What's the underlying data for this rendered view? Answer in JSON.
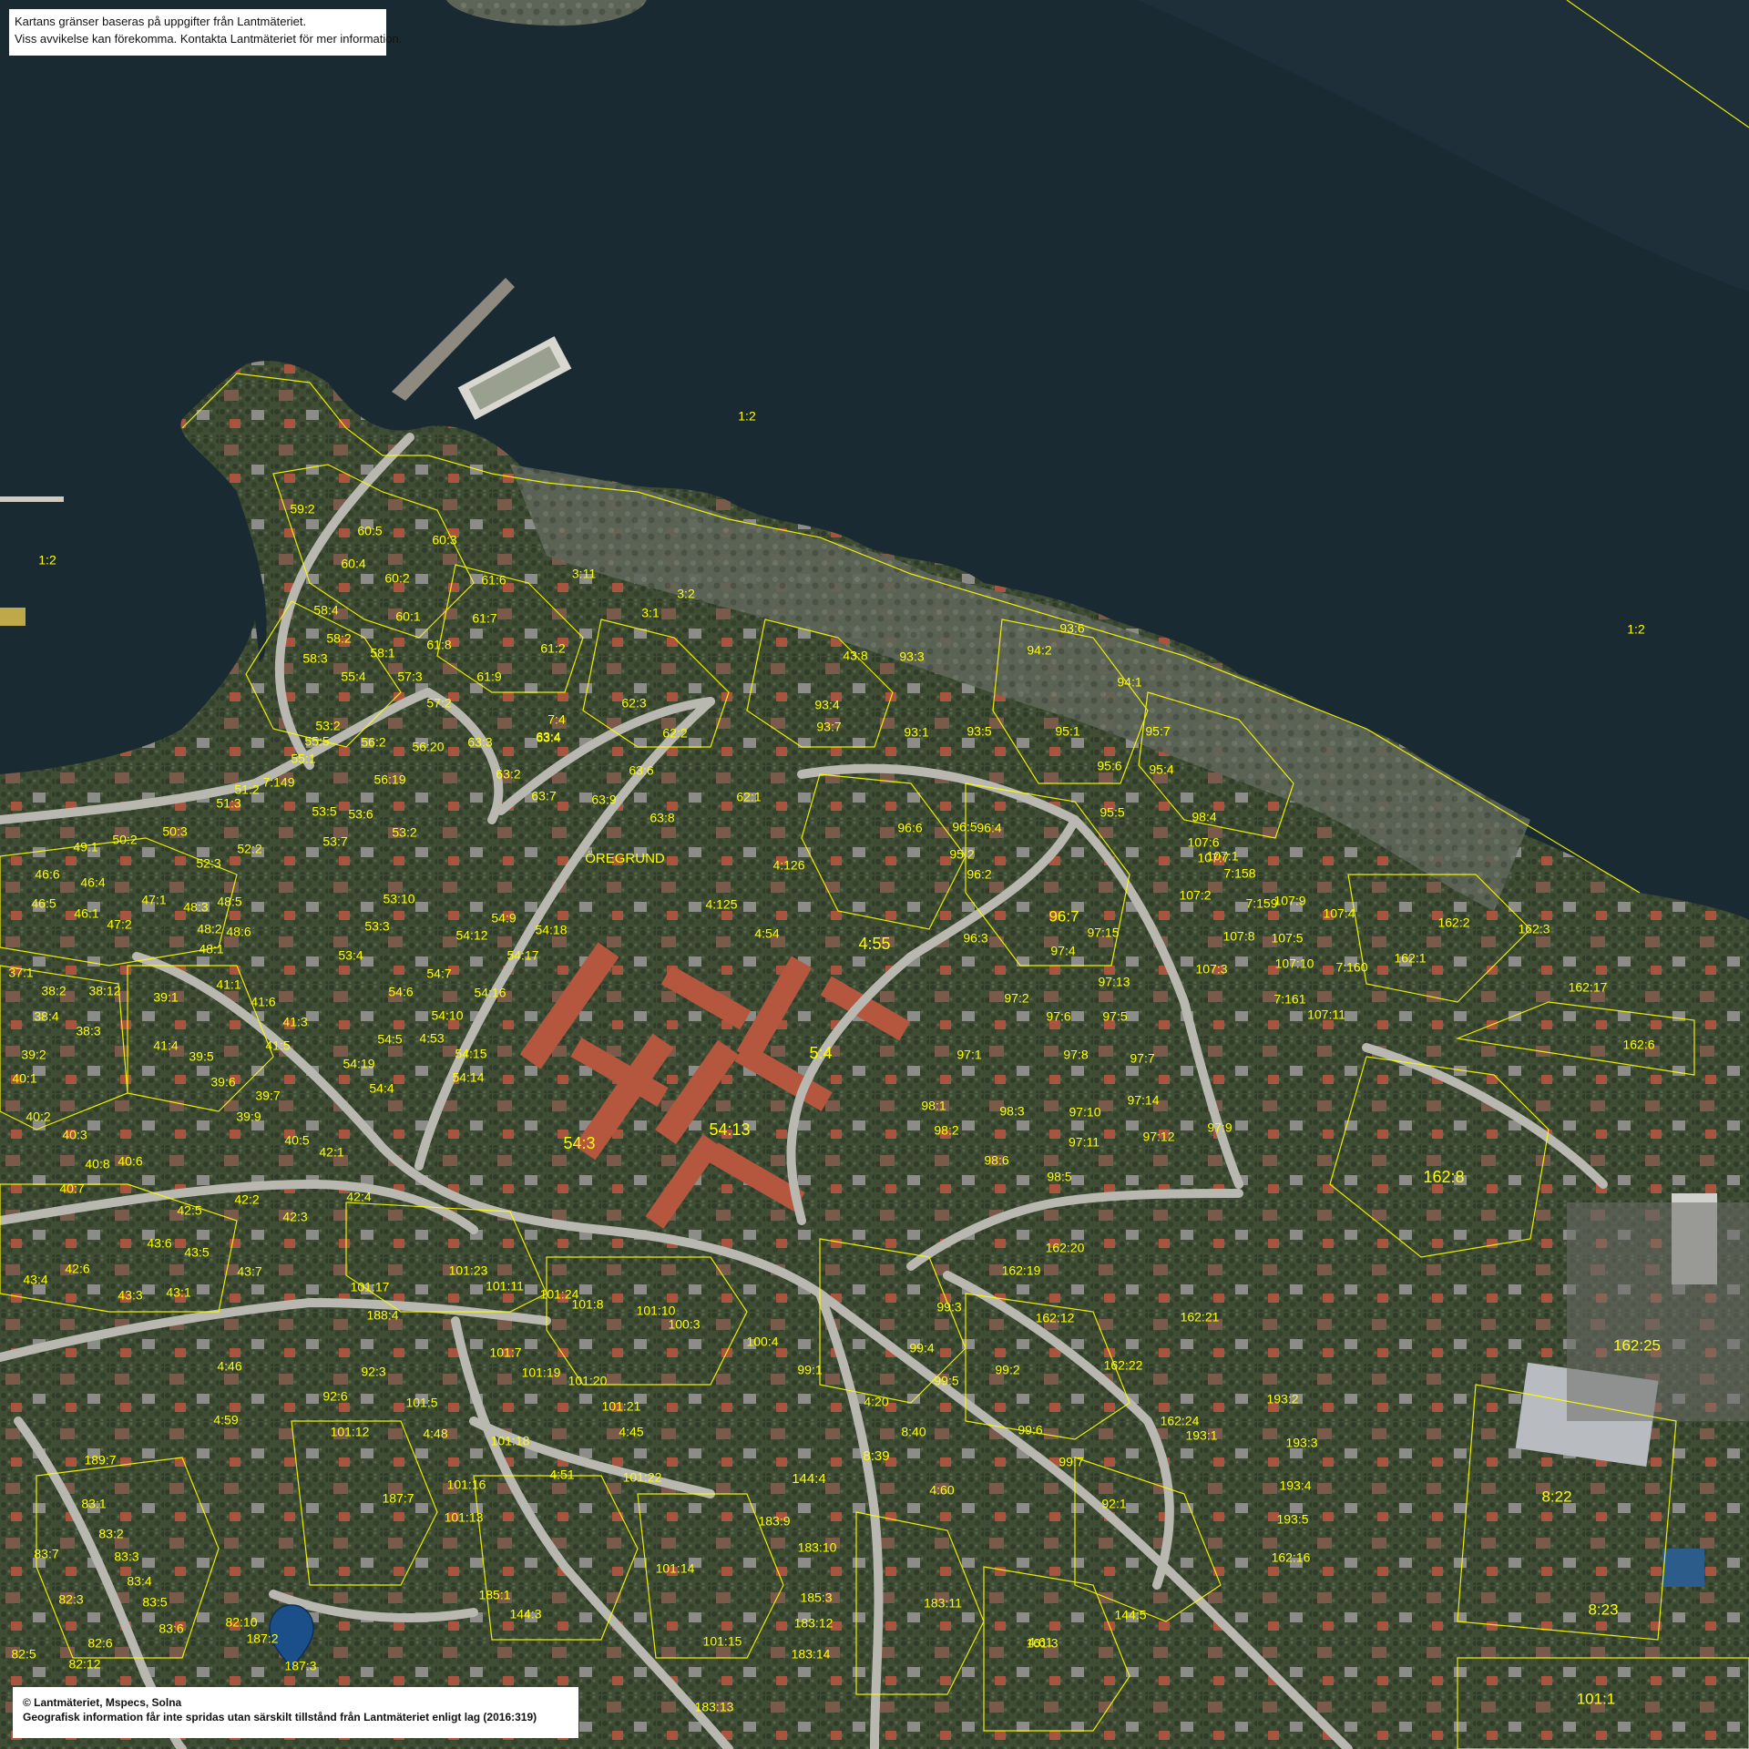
{
  "notices": {
    "boundary_line1": "Kartans gränser baseras på uppgifter från Lantmäteriet.",
    "boundary_line2": "Viss avvikelse kan förekomma. Kontakta Lantmäteriet för mer information.",
    "copyright_line1": "© Lantmäteriet, Mspecs, Solna",
    "copyright_line2": "Geografisk information får inte spridas utan särskilt tillstånd från Lantmäteriet enligt lag (2016:319)"
  },
  "colors": {
    "water": "#1a2a33",
    "land": "#4a5a3e",
    "roads": "#b8b8b0",
    "parcel_boundaries": "#ffff00",
    "pin": "#1a4f8a"
  },
  "places": [
    "ÖREGRUND",
    "ÖREGRUND"
  ],
  "parcel_labels": [
    "1:2",
    "1:2",
    "1:2",
    "59:2",
    "60:5",
    "60:3",
    "60:4",
    "60:2",
    "61:6",
    "3:11",
    "3:2",
    "3:1",
    "58:4",
    "60:1",
    "61:7",
    "61:2",
    "58:2",
    "58:1",
    "61:8",
    "58:3",
    "55:4",
    "57:3",
    "61:9",
    "57:2",
    "53:2",
    "55:5",
    "55:1",
    "56:2",
    "56:20",
    "63:3",
    "63:4",
    "62:3",
    "62:2",
    "7:4",
    "63:6",
    "63:4",
    "63:2",
    "63:7",
    "63:9",
    "63:8",
    "62:1",
    "56:19",
    "51:2",
    "51:3",
    "7:149",
    "53:5",
    "53:6",
    "53:7",
    "50:2",
    "50:3",
    "49:1",
    "52:3",
    "52:2",
    "ÖREGRUND",
    "4:126",
    "53:2",
    "53:10",
    "54:9",
    "54:12",
    "54:18",
    "54:17",
    "4:125",
    "4:54",
    "4:55",
    "53:3",
    "53:4",
    "54:7",
    "54:16",
    "54:6",
    "54:10",
    "4:53",
    "54:15",
    "54:5",
    "54:19",
    "54:14",
    "54:4",
    "54:3",
    "54:13",
    "5:4",
    "46:6",
    "46:4",
    "46:5",
    "46:1",
    "47:2",
    "47:1",
    "48:3",
    "48:5",
    "48:2",
    "48:6",
    "48:1",
    "37:1",
    "38:2",
    "38:12",
    "38:4",
    "38:3",
    "39:1",
    "41:1",
    "41:6",
    "41:3",
    "41:5",
    "41:4",
    "39:5",
    "39:6",
    "39:7",
    "39:9",
    "39:2",
    "40:1",
    "40:2",
    "40:3",
    "40:8",
    "40:6",
    "40:7",
    "40:5",
    "42:1",
    "42:2",
    "42:4",
    "42:3",
    "42:5",
    "43:6",
    "43:5",
    "43:7",
    "42:6",
    "43:4",
    "43:3",
    "43:1",
    "43:8",
    "93:3",
    "93:4",
    "93:7",
    "93:1",
    "93:5",
    "93:6",
    "94:2",
    "94:1",
    "95:1",
    "95:7",
    "95:6",
    "95:4",
    "95:5",
    "95:2",
    "96:5",
    "96:6",
    "96:4",
    "96:2",
    "96:3",
    "96:7",
    "97:15",
    "97:4",
    "97:2",
    "97:13",
    "97:6",
    "97:5",
    "97:8",
    "97:7",
    "97:10",
    "97:14",
    "97:12",
    "97:9",
    "97:11",
    "97:1",
    "98:1",
    "98:2",
    "98:3",
    "98:6",
    "98:5",
    "98:4",
    "107:6",
    "107:1",
    "107:7",
    "107:2",
    "7:158",
    "7:159",
    "107:8",
    "107:3",
    "107:9",
    "107:4",
    "107:5",
    "107:10",
    "7:160",
    "7:161",
    "107:11",
    "162:2",
    "162:3",
    "162:1",
    "162:17",
    "162:6",
    "162:8",
    "162:20",
    "162:19",
    "162:12",
    "162:21",
    "162:22",
    "162:24",
    "193:1",
    "193:2",
    "193:3",
    "193:4",
    "193:5",
    "162:16",
    "162:25",
    "8:22",
    "8:23",
    "101:1",
    "101:23",
    "101:11",
    "101:24",
    "101:8",
    "101:10",
    "100:3",
    "100:4",
    "99:1",
    "99:2",
    "99:3",
    "99:4",
    "99:5",
    "99:6",
    "99:7",
    "92:1",
    "101:17",
    "188:4",
    "92:3",
    "92:6",
    "101:12",
    "101:5",
    "101:7",
    "101:19",
    "101:20",
    "101:21",
    "4:45",
    "4:46",
    "4:59",
    "4:20",
    "8:40",
    "8:39",
    "144:4",
    "4:60",
    "183:9",
    "183:10",
    "101:18",
    "4:51",
    "101:22",
    "101:16",
    "101:13",
    "185:1",
    "185:3",
    "101:14",
    "183:11",
    "4:61",
    "144:5",
    "161:3",
    "144:3",
    "101:15",
    "183:12",
    "183:14",
    "183:13",
    "189:7",
    "83:1",
    "83:2",
    "83:3",
    "83:4",
    "83:5",
    "83:6",
    "83:7",
    "82:3",
    "82:5",
    "82:6",
    "82:12",
    "82:10",
    "187:2",
    "187:3",
    "187:7",
    "4:48",
    "3:1"
  ]
}
